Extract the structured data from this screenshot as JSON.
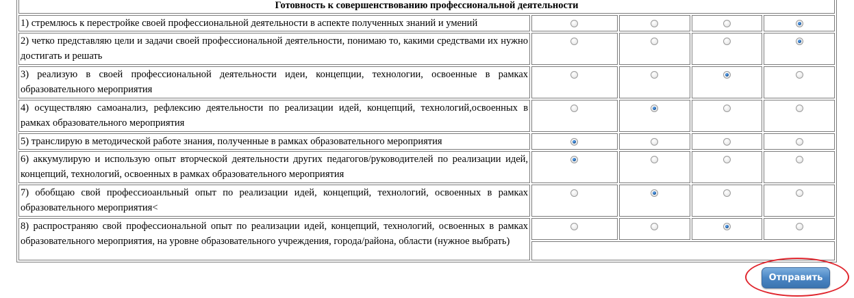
{
  "section_title": "Готовность к совершенствованию профессиональной деятельности",
  "questions": [
    {
      "text": "1) стремлюсь к перестройке своей профессиональной деятельности в аспекте полученных знаний и умений",
      "selected": 4
    },
    {
      "text": "2) четко представляю цели и задачи своей профессиональной деятельности, понимаю то, какими средствами их нужно достигать и решать",
      "selected": 4
    },
    {
      "text": "3) реализую в своей профессиональной деятельности идеи, концепции, технологии, освоенные в рамках образовательного мероприятия",
      "selected": 3
    },
    {
      "text": "4) осуществляю самоанализ, рефлексию деятельности по реализации идей, концепций, технологий,освоенных в рамках образовательного мероприятия",
      "selected": 2
    },
    {
      "text": "5) транслирую в методической работе знания, полученные в рамках образовательного мероприятия",
      "selected": 1
    },
    {
      "text": "6) аккумулирую и использую опыт вторческой деятельности других педагогов/руководителей по реализации идей, концепций, технологий, освоенных в рамках образовательного мероприятия",
      "selected": 1
    },
    {
      "text": "7) обобщаю свой профессиоанльный опыт по реализации идей, концепций, технологий, освоенных в рамках образовательного мероприятия<",
      "selected": 2
    },
    {
      "text": "8) распространяю свой профессиональной опыт по реализации идей, концепций, технологий, освоенных в рамках образовательного мероприятия, на уровне образовательного учреждения, города/района, области (нужное выбрать)",
      "selected": 3
    }
  ],
  "submit_label": "Отправить",
  "colors": {
    "button": "#4a86c4",
    "highlight": "#e0262e",
    "radio_checked": "#1c5fa8"
  }
}
